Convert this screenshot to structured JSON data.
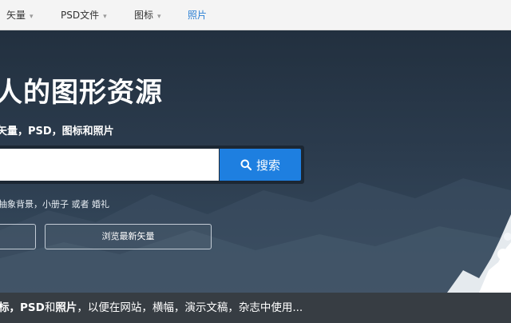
{
  "nav": {
    "items": [
      {
        "label": "矢量",
        "dropdown": true
      },
      {
        "label": "PSD文件",
        "dropdown": true
      },
      {
        "label": "图标",
        "dropdown": true
      },
      {
        "label": "照片",
        "dropdown": false,
        "active": true
      }
    ],
    "caret": "▾"
  },
  "hero": {
    "title": "人的图形资源",
    "subtitle": "矢量，PSD，图标和照片",
    "search": {
      "value": "",
      "button_label": "搜索",
      "button_icon": "search-icon"
    },
    "suggestions": "抽象背景，小册子 或者 婚礼",
    "button_left_label": "",
    "button_browse_label": "浏览最新矢量"
  },
  "tagline": {
    "part1": "标，",
    "part2": "PSD",
    "part3": "和",
    "part4": "照片",
    "part5": "，以便在网站，横幅，演示文稿，杂志中使用..."
  },
  "colors": {
    "accent": "#1e7fe0",
    "nav_active": "#2a7fd4",
    "hero_bg": "#2a3846",
    "tagbar_bg": "#373d43"
  }
}
